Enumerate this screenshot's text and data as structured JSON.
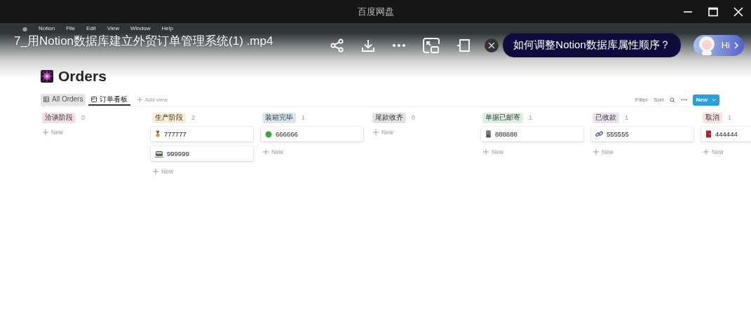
{
  "window": {
    "title": "百度网盘"
  },
  "mac_menu": [
    "Notion",
    "File",
    "Edit",
    "View",
    "Window",
    "Help"
  ],
  "video": {
    "title": "7_用Notion数据库建立外贸订单管理系统(1) .mp4"
  },
  "ai_prompt": {
    "question": "如何调整Notion数据库属性顺序？",
    "greeting": "Hi"
  },
  "page": {
    "title": "Orders",
    "views": [
      {
        "label": "All Orders",
        "kind": "table",
        "selected": false
      },
      {
        "label": "订单看板",
        "kind": "board",
        "selected": true
      }
    ],
    "add_view": "Add view",
    "filter": "Filter",
    "sort": "Sort",
    "new_button": "New"
  },
  "board": {
    "columns": [
      {
        "name": "洽谈阶段",
        "color": "#f5e0e9",
        "count": "0",
        "new_label": "New"
      },
      {
        "name": "生产阶段",
        "color": "#fbf0d4",
        "count": "2",
        "new_label": "New",
        "cards": [
          {
            "title": "777777",
            "kind": "medal"
          },
          {
            "title": "999999",
            "kind": "train"
          }
        ]
      },
      {
        "name": "装箱完毕",
        "color": "#d9e8f1",
        "count": "1",
        "new_label": "New",
        "cards": [
          {
            "title": "666666",
            "kind": "circle"
          }
        ]
      },
      {
        "name": "尾款收齐",
        "color": "#e3e2e0",
        "count": "0",
        "new_label": "New"
      },
      {
        "name": "单据已邮寄",
        "color": "#dcefe2",
        "count": "1",
        "new_label": "New",
        "cards": [
          {
            "title": "888888",
            "kind": "building"
          }
        ]
      },
      {
        "name": "已收款",
        "color": "#ebe3f3",
        "count": "1",
        "new_label": "New",
        "cards": [
          {
            "title": "555555",
            "kind": "link"
          }
        ]
      },
      {
        "name": "取消",
        "color": "#fbe2e2",
        "count": "1",
        "new_label": "New",
        "cards": [
          {
            "title": "444444",
            "kind": "door"
          }
        ]
      }
    ]
  }
}
